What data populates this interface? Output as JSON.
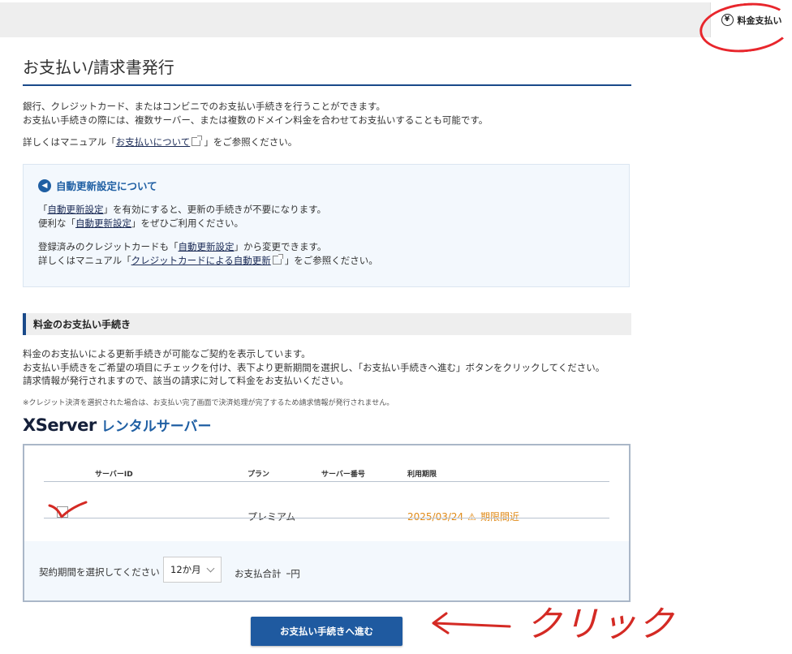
{
  "topbar": {
    "pay_label": "料金支払い",
    "pay_icon": "yen-circle-icon"
  },
  "page": {
    "title": "お支払い/請求書発行",
    "intro": [
      "銀行、クレジットカード、またはコンビニでのお支払い手続きを行うことができます。",
      "お支払い手続きの際には、複数サーバー、または複数のドメイン料金を合わせてお支払いすることも可能です。"
    ],
    "manual_prefix": "詳しくはマニュアル「",
    "manual_link": "お支払いについて",
    "manual_suffix": "」をご参照ください。"
  },
  "info_box": {
    "title": "自動更新設定について",
    "l1_a": "「",
    "l1_link": "自動更新設定",
    "l1_b": "」を有効にすると、更新の手続きが不要になります。",
    "l2_a": "便利な「",
    "l2_link": "自動更新設定",
    "l2_b": "」をぜひご利用ください。",
    "l3_a": "登録済みのクレジットカードも「",
    "l3_link": "自動更新設定",
    "l3_b": "」から変更できます。",
    "l4_a": "詳しくはマニュアル「",
    "l4_link": "クレジットカードによる自動更新",
    "l4_b": "」をご参照ください。"
  },
  "section": {
    "title": "料金のお支払い手続き",
    "desc": [
      "料金のお支払いによる更新手続きが可能なご契約を表示しています。",
      "お支払い手続きをご希望の項目にチェックを付け、表下より更新期間を選択し、「お支払い手続きへ進む」ボタンをクリックしてください。",
      "請求情報が発行されますので、該当の請求に対して料金をお支払いください。"
    ],
    "note": "※クレジット決済を選択された場合は、お支払い完了画面で決済処理が完了するため請求情報が発行されません。"
  },
  "brand": {
    "logo": "XServer",
    "sub": "レンタルサーバー"
  },
  "server_table": {
    "headers": {
      "server_id": "サーバーID",
      "plan": "プラン",
      "server_no": "サーバー番号",
      "period": "利用期限"
    },
    "rows": [
      {
        "server_id": "",
        "plan": "プレミアム",
        "server_no": "",
        "date": "2025/03/24",
        "status": "期限間近"
      }
    ]
  },
  "period_select": {
    "label": "契約期間を選択してください",
    "value": "12か月",
    "total_label": "お支払合計",
    "total_value": "ｰ円"
  },
  "submit": {
    "label": "お支払い手続きへ進む"
  },
  "annotation": {
    "click_text": "クリック"
  },
  "colors": {
    "accent": "#1a4a8a",
    "button": "#1f5aa0",
    "warning": "#e08a17",
    "annotation": "#d42a24"
  }
}
